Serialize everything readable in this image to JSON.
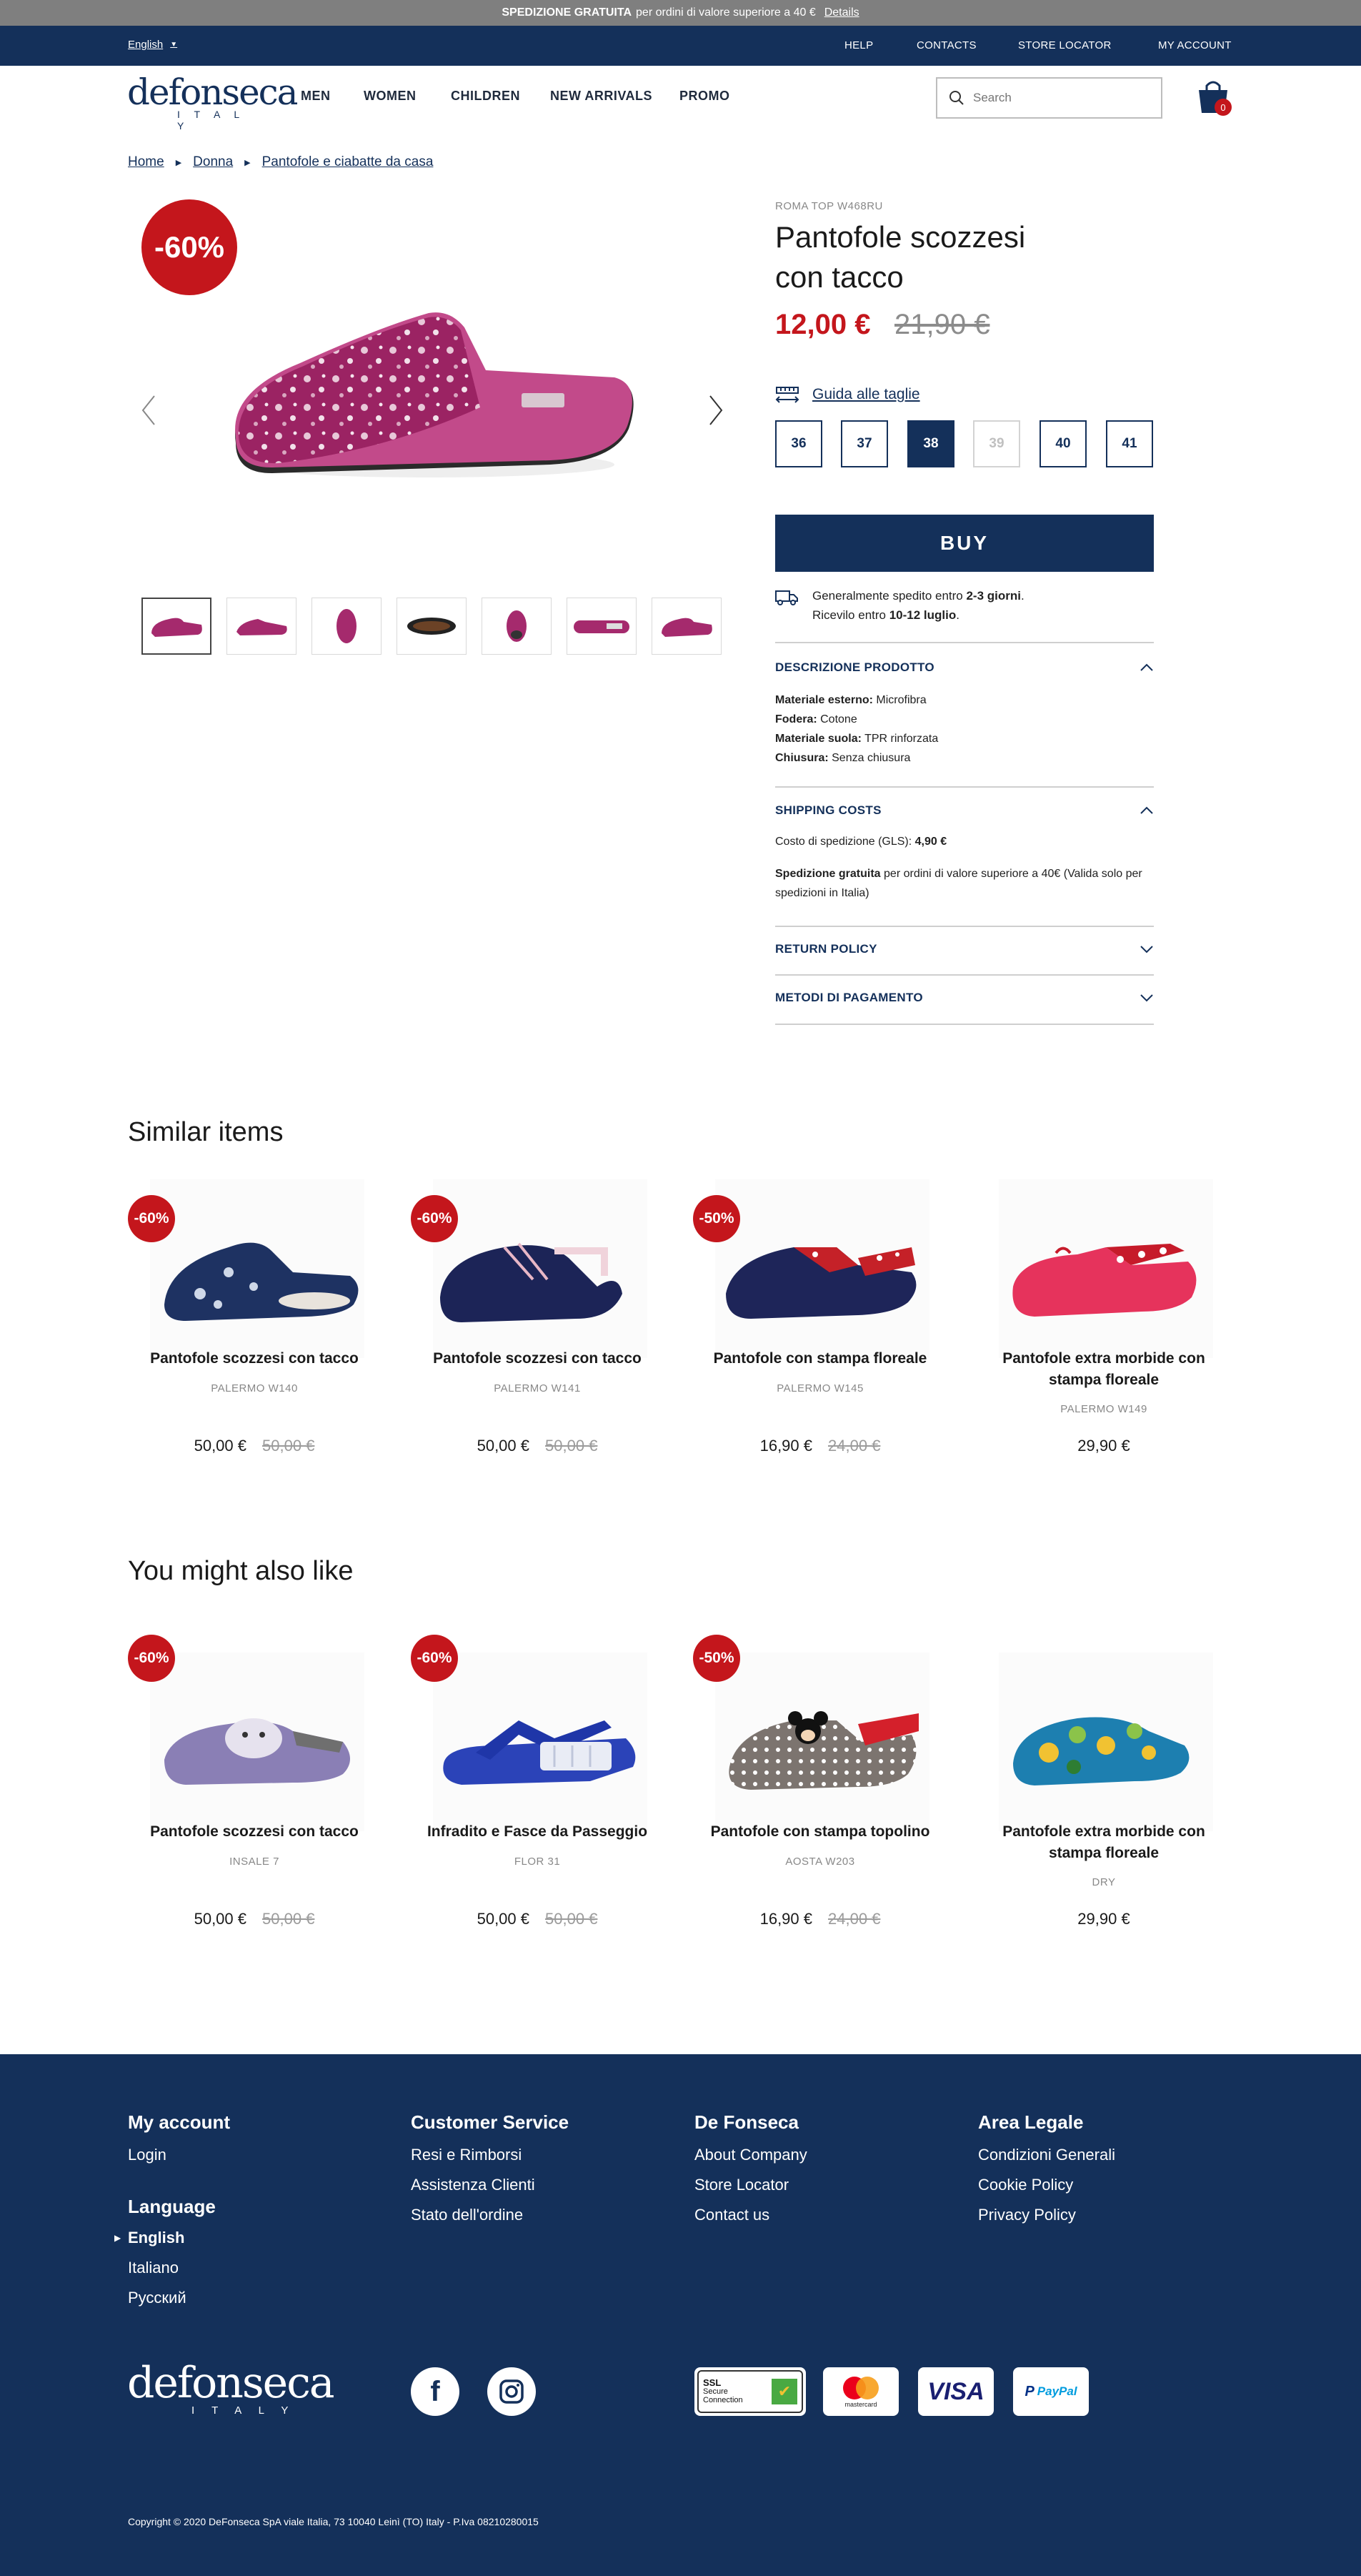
{
  "promo": {
    "bold": "SPEDIZIONE GRATUITA",
    "text": "per ordini di valore superiore a 40 €",
    "link": "Details"
  },
  "util": {
    "language": "English",
    "links": [
      "HELP",
      "CONTACTS",
      "STORE LOCATOR",
      "MY ACCOUNT"
    ]
  },
  "header": {
    "logo_main": "defonseca",
    "logo_sub": "I T A L Y",
    "nav": [
      "MEN",
      "WOMEN",
      "CHILDREN",
      "NEW ARRIVALS",
      "PROMO"
    ],
    "search_placeholder": "Search",
    "cart_count": "0"
  },
  "breadcrumb": [
    "Home",
    "Donna",
    "Pantofole e ciabatte da casa"
  ],
  "product": {
    "discount": "-60%",
    "sku": "ROMA TOP W468RU",
    "title_line1": "Pantofole scozzesi",
    "title_line2": "con tacco",
    "price": "12,00 €",
    "old_price": "21,90 €",
    "size_guide": "Guida alle taglie",
    "sizes": [
      "36",
      "37",
      "38",
      "39",
      "40",
      "41"
    ],
    "selected_size": "38",
    "unavailable_size": "39",
    "buy_label": "BUY",
    "shipping_line1_pre": "Generalmente spedito entro ",
    "shipping_line1_bold": "2-3 giorni",
    "shipping_line2_pre": "Ricevilo entro ",
    "shipping_line2_bold": "10-12 luglio",
    "description": {
      "title": "DESCRIZIONE PRODOTTO",
      "rows": [
        {
          "label": "Materiale esterno:",
          "value": "Microfibra"
        },
        {
          "label": "Fodera:",
          "value": "Cotone"
        },
        {
          "label": "Materiale suola:",
          "value": "TPR rinforzata"
        },
        {
          "label": "Chiusura:",
          "value": "Senza chiusura"
        }
      ]
    },
    "shipping_costs": {
      "title": "SHIPPING COSTS",
      "cost_label": "Costo di spedizione (GLS):",
      "cost_value": "4,90 €",
      "free_bold": "Spedizione gratuita",
      "free_text": "per ordini di valore superiore a 40€ (Valida solo per spedizioni in Italia)"
    },
    "return_policy": "RETURN POLICY",
    "payment_methods": "METODI DI PAGAMENTO"
  },
  "similar": {
    "title": "Similar items",
    "items": [
      {
        "badge": "-60%",
        "name": "Pantofole scozzesi con tacco",
        "code": "PALERMO W140",
        "price": "50,00 €",
        "old": "50,00 €"
      },
      {
        "badge": "-60%",
        "name": "Pantofole scozzesi con tacco",
        "code": "PALERMO W141",
        "price": "50,00 €",
        "old": "50,00 €"
      },
      {
        "badge": "-50%",
        "name": "Pantofole con stampa floreale",
        "code": "PALERMO W145",
        "price": "16,90 €",
        "old": "24,00 €"
      },
      {
        "badge": "",
        "name": "Pantofole extra morbide con stampa floreale",
        "code": "PALERMO W149",
        "price": "29,90 €",
        "old": ""
      }
    ]
  },
  "also": {
    "title": "You might also like",
    "items": [
      {
        "badge": "-60%",
        "name": "Pantofole scozzesi con tacco",
        "code": "INSALE 7",
        "price": "50,00 €",
        "old": "50,00 €"
      },
      {
        "badge": "-60%",
        "name": "Infradito e Fasce da Passeggio",
        "code": "FLOR 31",
        "price": "50,00 €",
        "old": "50,00 €"
      },
      {
        "badge": "-50%",
        "name": "Pantofole con stampa topolino",
        "code": "AOSTA W203",
        "price": "16,90 €",
        "old": "24,00 €"
      },
      {
        "badge": "",
        "name": "Pantofole extra morbide con stampa floreale",
        "code": "DRY",
        "price": "29,90 €",
        "old": ""
      }
    ]
  },
  "footer": {
    "my_account": {
      "title": "My account",
      "links": [
        "Login"
      ]
    },
    "language": {
      "title": "Language",
      "links": [
        "English",
        "Italiano",
        "Русский"
      ]
    },
    "customer_service": {
      "title": "Customer Service",
      "links": [
        "Resi e Rimborsi",
        "Assistenza Clienti",
        "Stato dell'ordine"
      ]
    },
    "defonseca": {
      "title": "De Fonseca",
      "links": [
        "About Company",
        "Store Locator",
        "Contact us"
      ]
    },
    "legal": {
      "title": "Area Legale",
      "links": [
        "Condizioni Generali",
        "Cookie Policy",
        "Privacy Policy"
      ]
    },
    "ssl": {
      "line1": "SSL",
      "line2": "Secure",
      "line3": "Connection"
    },
    "mastercard": "mastercard",
    "visa": "VISA",
    "paypal": "PayPal",
    "copyright": "Copyright © 2020 DeFonseca SpA viale Italia, 73 10040 Leinì (TO) Italy - P.Iva 08210280015"
  },
  "colors": {
    "navy": "#14305a",
    "red": "#c4161c",
    "promo_grey": "#7f7f7f"
  }
}
